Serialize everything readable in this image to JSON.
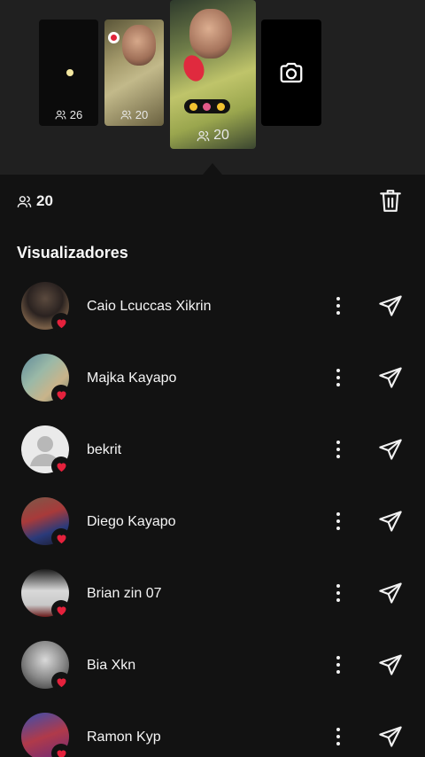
{
  "story_strip": {
    "thumbnails": [
      {
        "count": "26"
      },
      {
        "count": "20"
      },
      {
        "count": "20",
        "selected": true
      },
      {
        "type": "add-story",
        "icon": "camera-icon"
      }
    ]
  },
  "header": {
    "viewer_count": "20",
    "icons": {
      "viewers": "people-icon",
      "delete": "trash-icon"
    }
  },
  "section_title": "Visualizadores",
  "viewers": [
    {
      "name": "Caio Lcuccas Xikrin"
    },
    {
      "name": "Majka Kayapo"
    },
    {
      "name": "bekrit"
    },
    {
      "name": "Diego Kayapo"
    },
    {
      "name": "Brian zin 07"
    },
    {
      "name": "Bia Xkn"
    },
    {
      "name": "Ramon Kyp"
    }
  ],
  "colors": {
    "background": "#121212",
    "strip_background": "#202020",
    "heart": "#e5213c",
    "text": "#f5f5f5"
  }
}
